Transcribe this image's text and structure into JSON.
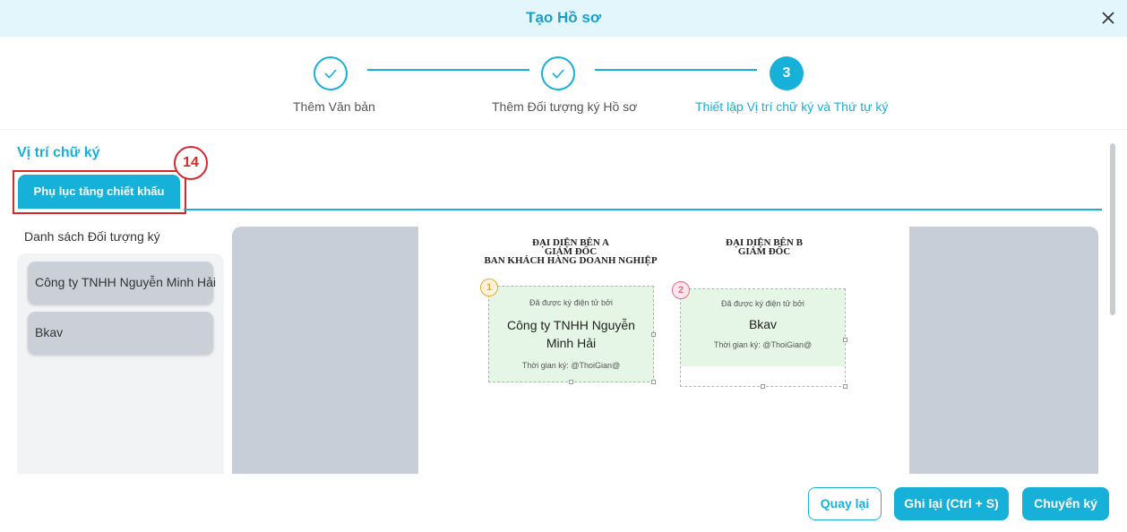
{
  "header": {
    "title": "Tạo Hồ sơ"
  },
  "stepper": {
    "steps": [
      {
        "label": "Thêm Văn bản",
        "state": "done"
      },
      {
        "label": "Thêm Đối tượng ký Hồ sơ",
        "state": "done"
      },
      {
        "label": "Thiết lập Vị trí chữ ký và Thứ tự ký",
        "state": "active",
        "number": "3"
      }
    ]
  },
  "section": {
    "title": "Vị trí chữ ký"
  },
  "annotation": {
    "number": "14"
  },
  "tabs": [
    {
      "label": "Phụ lục tăng chiết khấu",
      "active": true
    }
  ],
  "signer_list": {
    "title": "Danh sách Đối tượng ký",
    "items": [
      {
        "label": "Công ty TNHH Nguyễn Minh Hải"
      },
      {
        "label": "Bkav"
      }
    ]
  },
  "document": {
    "party_a": {
      "lines": [
        "ĐẠI DIỆN BÊN A",
        "GIÁM ĐỐC",
        "BAN KHÁCH HÀNG DOANH NGHIỆP"
      ]
    },
    "party_b": {
      "lines": [
        "ĐẠI DIỆN BÊN B",
        "GIÁM ĐỐC"
      ]
    },
    "signature_boxes": [
      {
        "order": "1",
        "signed_by_label": "Đã được ký điện tử bởi",
        "name": "Công ty TNHH Nguyễn Minh Hải",
        "time_label": "Thời gian ký: @ThoiGian@",
        "badge_color": "#e8a92a",
        "badge_bg": "#fdf3dc"
      },
      {
        "order": "2",
        "signed_by_label": "Đã được ký điện tử bởi",
        "name": "Bkav",
        "time_label": "Thời gian ký: @ThoiGian@",
        "badge_color": "#e56b87",
        "badge_bg": "#fde6ec"
      }
    ]
  },
  "actions": {
    "back_label": "Quay lại",
    "save_label": "Ghi lại (Ctrl + S)",
    "send_label": "Chuyển ký"
  },
  "colors": {
    "accent": "#17b0d8",
    "header_bg": "#e3f6fc",
    "annotation": "#d9262a"
  }
}
